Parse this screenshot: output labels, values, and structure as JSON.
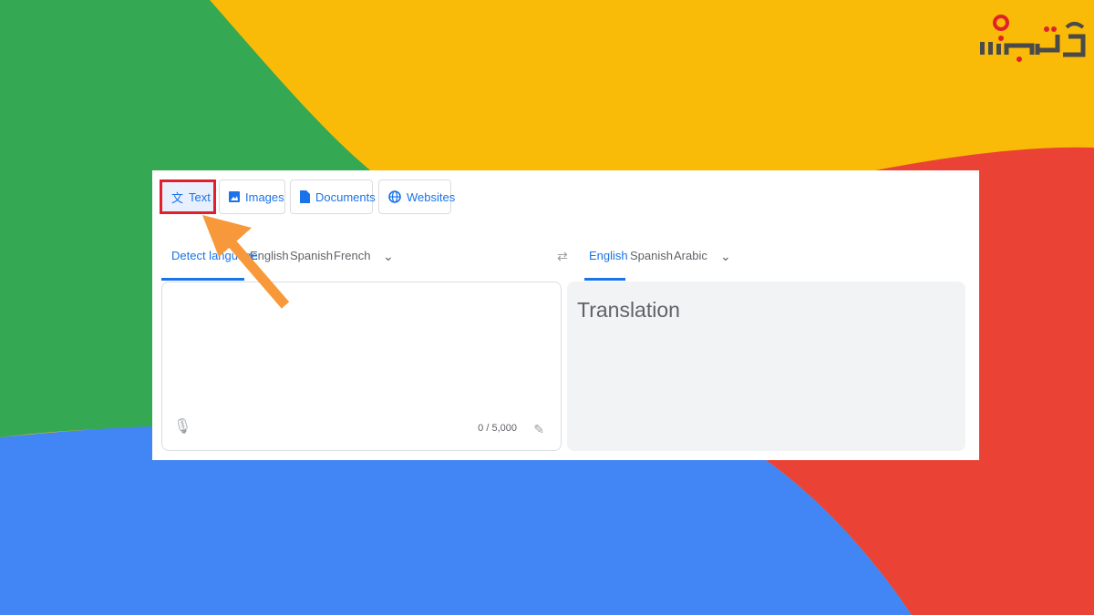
{
  "logo": {
    "text": "آچارباز"
  },
  "colors": {
    "green": "#34a853",
    "yellow": "#f9bb07",
    "red": "#ea4335",
    "blue": "#4285f4",
    "accent": "#1a73e8",
    "highlight": "#e0202a",
    "arrow": "#f7993a"
  },
  "modes": [
    {
      "label": "Text",
      "icon": "translate-icon",
      "active": true
    },
    {
      "label": "Images",
      "icon": "image-icon"
    },
    {
      "label": "Documents",
      "icon": "document-icon"
    },
    {
      "label": "Websites",
      "icon": "globe-icon"
    }
  ],
  "source_langs": [
    "Detect language",
    "English",
    "Spanish",
    "French"
  ],
  "target_langs": [
    "English",
    "Spanish",
    "Arabic"
  ],
  "source": {
    "value": "",
    "char_count": "0 / 5,000"
  },
  "target": {
    "placeholder": "Translation"
  }
}
